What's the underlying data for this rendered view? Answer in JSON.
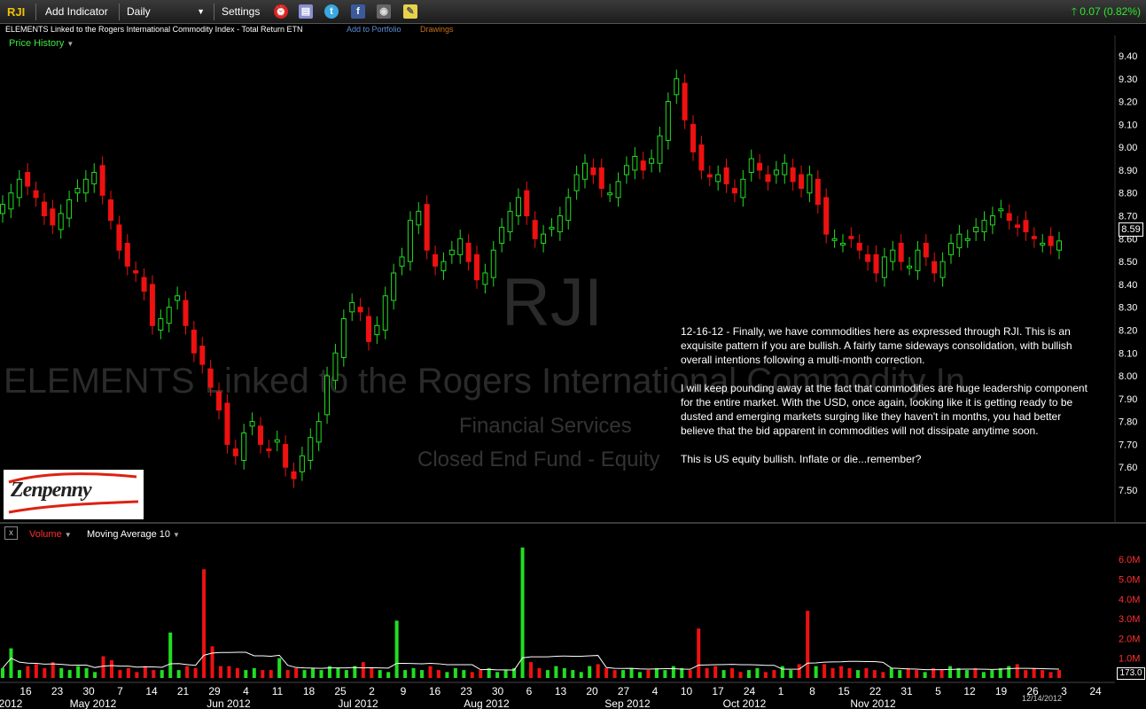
{
  "toolbar": {
    "symbol": "RJI",
    "add_indicator": "Add Indicator",
    "period": "Daily",
    "settings": "Settings",
    "change_text": "0.07 (0.82%)"
  },
  "info": {
    "full_name": "ELEMENTS Linked to the Rogers International Commodity Index - Total Return ETN",
    "add_to_portfolio": "Add to Portfolio",
    "drawings": "Drawings",
    "price_history": "Price History"
  },
  "watermark": {
    "symbol": "RJI",
    "name": "ELEMENTS Linked to the Rogers International Commodity In",
    "sector": "Financial Services",
    "industry": "Closed End Fund - Equity"
  },
  "annotation": {
    "p1": "12-16-12 - Finally, we have commodities here as expressed through RJI. This is an exquisite pattern if you are bullish. A fairly tame sideways consolidation, with bullish overall intentions following a multi-month correction.",
    "p2": "I will keep pounding away at the fact that commodities are huge leadership component for the entire market. With the USD, once again, looking like it is getting ready to be dusted and emerging markets surging like they haven't in months, you had better believe that the bid apparent in commodities will not dissipate anytime soon.",
    "p3": "This is US equity bullish. Inflate or die...remember?"
  },
  "logo_text": "Zenpenny",
  "last_price": "8.59",
  "volume_pane": {
    "label": "Volume",
    "ma_label": "Moving Average 10",
    "last_value": "173.0"
  },
  "date_stamp": "12/14/2012",
  "colors": {
    "up": "#22dd22",
    "down": "#ee1111",
    "accent": "#f2c200"
  },
  "chart_data": {
    "type": "candlestick",
    "price_axis": {
      "ticks": [
        "9.40",
        "9.30",
        "9.20",
        "9.10",
        "9.00",
        "8.90",
        "8.80",
        "8.70",
        "8.60",
        "8.50",
        "8.40",
        "8.30",
        "8.20",
        "8.10",
        "8.00",
        "7.90",
        "7.80",
        "7.70",
        "7.60",
        "7.50"
      ],
      "range": [
        7.5,
        9.4
      ]
    },
    "volume_axis": {
      "ticks": [
        "6.0M",
        "5.0M",
        "4.0M",
        "3.0M",
        "2.0M",
        "1.0M"
      ],
      "range": [
        0,
        6.5
      ]
    },
    "x_day_labels": [
      "16",
      "23",
      "30",
      "7",
      "14",
      "21",
      "29",
      "4",
      "11",
      "18",
      "25",
      "2",
      "9",
      "16",
      "23",
      "30",
      "6",
      "13",
      "20",
      "27",
      "4",
      "10",
      "17",
      "24",
      "1",
      "8",
      "15",
      "22",
      "31",
      "5",
      "12",
      "19",
      "26",
      "3",
      "24"
    ],
    "x_month_labels": [
      "2012",
      "May 2012",
      "Jun 2012",
      "Jul 2012",
      "Aug 2012",
      "Sep 2012",
      "Oct 2012",
      "Nov 2012"
    ],
    "closes": [
      8.75,
      8.8,
      8.86,
      8.83,
      8.78,
      8.7,
      8.66,
      8.71,
      8.77,
      8.82,
      8.86,
      8.89,
      8.79,
      8.68,
      8.55,
      8.48,
      8.45,
      8.37,
      8.22,
      8.25,
      8.3,
      8.35,
      8.22,
      8.1,
      8.05,
      7.95,
      7.85,
      7.7,
      7.65,
      7.75,
      7.8,
      7.7,
      7.68,
      7.72,
      7.6,
      7.55,
      7.65,
      7.73,
      7.8,
      8.0,
      8.1,
      8.25,
      8.32,
      8.28,
      8.15,
      8.22,
      8.35,
      8.45,
      8.52,
      8.68,
      8.72,
      8.55,
      8.48,
      8.5,
      8.55,
      8.6,
      8.5,
      8.42,
      8.45,
      8.55,
      8.65,
      8.72,
      8.78,
      8.7,
      8.6,
      8.62,
      8.65,
      8.7,
      8.78,
      8.88,
      8.93,
      8.88,
      8.82,
      8.8,
      8.85,
      8.92,
      8.96,
      8.9,
      8.95,
      9.05,
      9.2,
      9.3,
      9.12,
      8.98,
      8.9,
      8.87,
      8.88,
      8.84,
      8.8,
      8.86,
      8.95,
      8.9,
      8.85,
      8.9,
      8.93,
      8.85,
      8.82,
      8.88,
      8.75,
      8.62,
      8.6,
      8.58,
      8.6,
      8.55,
      8.5,
      8.45,
      8.52,
      8.55,
      8.5,
      8.48,
      8.55,
      8.52,
      8.45,
      8.5,
      8.58,
      8.62,
      8.6,
      8.65,
      8.68,
      8.7,
      8.73,
      8.68,
      8.65,
      8.63,
      8.6,
      8.58,
      8.57,
      8.59
    ],
    "volumes": [
      0.5,
      1.5,
      0.4,
      0.6,
      0.7,
      0.5,
      0.8,
      0.5,
      0.4,
      0.6,
      0.5,
      0.3,
      1.1,
      0.9,
      0.4,
      0.5,
      0.3,
      0.6,
      0.4,
      0.4,
      2.3,
      0.4,
      0.6,
      0.5,
      5.5,
      1.6,
      0.6,
      0.6,
      0.5,
      0.4,
      0.5,
      0.4,
      0.4,
      1.0,
      0.4,
      0.5,
      0.4,
      0.5,
      0.4,
      0.6,
      0.5,
      0.4,
      0.6,
      0.8,
      0.5,
      0.4,
      0.3,
      2.9,
      0.4,
      0.5,
      0.4,
      0.6,
      0.4,
      0.3,
      0.5,
      0.4,
      0.3,
      0.4,
      0.5,
      0.3,
      0.4,
      0.5,
      6.6,
      0.8,
      0.5,
      0.4,
      0.6,
      0.5,
      0.4,
      0.3,
      0.6,
      0.7,
      0.5,
      0.4,
      0.4,
      0.5,
      0.3,
      0.4,
      0.5,
      0.4,
      0.6,
      0.5,
      0.4,
      2.5,
      0.5,
      0.6,
      0.4,
      0.5,
      0.3,
      0.4,
      0.5,
      0.3,
      0.4,
      0.6,
      0.4,
      0.7,
      3.4,
      0.6,
      0.7,
      0.5,
      0.6,
      0.5,
      0.4,
      0.5,
      0.4,
      0.3,
      0.5,
      0.4,
      0.5,
      0.4,
      0.3,
      0.5,
      0.4,
      0.6,
      0.5,
      0.4,
      0.5,
      0.3,
      0.4,
      0.5,
      0.6,
      0.7,
      0.4,
      0.5,
      0.4,
      0.3,
      0.4
    ]
  }
}
